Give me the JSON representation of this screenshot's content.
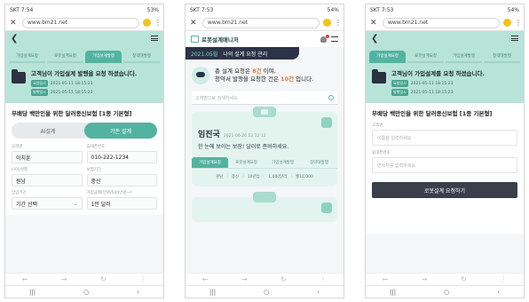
{
  "screens": {
    "first": {
      "status": {
        "carrier_time": "SKT 7:54",
        "battery": "53%"
      },
      "url": "www.bm21.net",
      "steps": [
        "가입설계요청",
        "로봇설계요청",
        "가입설계발행",
        "청약대발행"
      ],
      "active_step": 2,
      "message": "고객님이 가입설계 발행을 요청 하셨습니다.",
      "dates": [
        {
          "tag": "요청일시",
          "value": "2021-05-11 18:15:23"
        },
        {
          "tag": "발행일시",
          "value": "2021-05-11 18:15:23"
        }
      ],
      "product_title": "무배당 백만인을 위한 달러종신보험 [1종 기본형]",
      "toggle": {
        "left": "AI설계",
        "right": "기존 설계"
      },
      "fields": [
        {
          "label": "고객명",
          "value": "이지훈"
        },
        {
          "label": "휴대폰번호",
          "value": "010-222-1234"
        },
        {
          "label": "나이/성별",
          "value": "원남"
        },
        {
          "label": "보험기간",
          "value": "종신"
        },
        {
          "label": "납입기간",
          "value": "기간 선택"
        },
        {
          "label": "가입금액(만원/500만원~)",
          "value": "1만 달러"
        }
      ]
    },
    "second": {
      "status": {
        "carrier_time": "SKT 7:53",
        "battery": "54%"
      },
      "url": "www.bm21.net",
      "brand": "로봇설계매니저",
      "month": "2021.05월",
      "month_title": "나의 설계 요청 관리",
      "summary": {
        "l1a": "총 설계 요청은 ",
        "total": "8건",
        "l1b": " 이며,",
        "l2a": "청약서 발행을 요청한 건은 ",
        "issued": "10건",
        "l2b": " 입니다."
      },
      "search_placeholder": "고객명으로 검색하세요",
      "card": {
        "name": "임진국",
        "time": "2021-06-26 12:12:12",
        "plan": "한 눈에 보이는 보장! 달러로 준비하세요.",
        "steps": [
          "가입설계요청",
          "로봇설계요청",
          "가입설계발행",
          "청약대발행"
        ],
        "active_step": 0,
        "meta": [
          "원남",
          "종신",
          "10년납",
          "1,000달러",
          "월10,000"
        ]
      }
    },
    "third": {
      "status": {
        "carrier_time": "SKT 7:53",
        "battery": "54%"
      },
      "url": "www.bm21.net",
      "steps": [
        "가입설계요청",
        "로봇설계요청",
        "가입설계발행",
        "청약대발행"
      ],
      "active_step": 0,
      "message": "고객님이 가입설계를 요청 하셨습니다.",
      "dates": [
        {
          "tag": "요청일시",
          "value": "2021-05-11 18:15:23"
        },
        {
          "tag": "발행일시",
          "value": "2021-05-11 18:15:23"
        }
      ],
      "product_title": "무배당 백만인을 위한 달러종신보험 [1종 기본형]",
      "name_label": "고객명",
      "name_placeholder": "이름을 입력하세요",
      "phone_label": "휴대폰번호",
      "phone_placeholder": "연락처를 입력하세요",
      "submit": "로봇설계 요청하기"
    }
  }
}
